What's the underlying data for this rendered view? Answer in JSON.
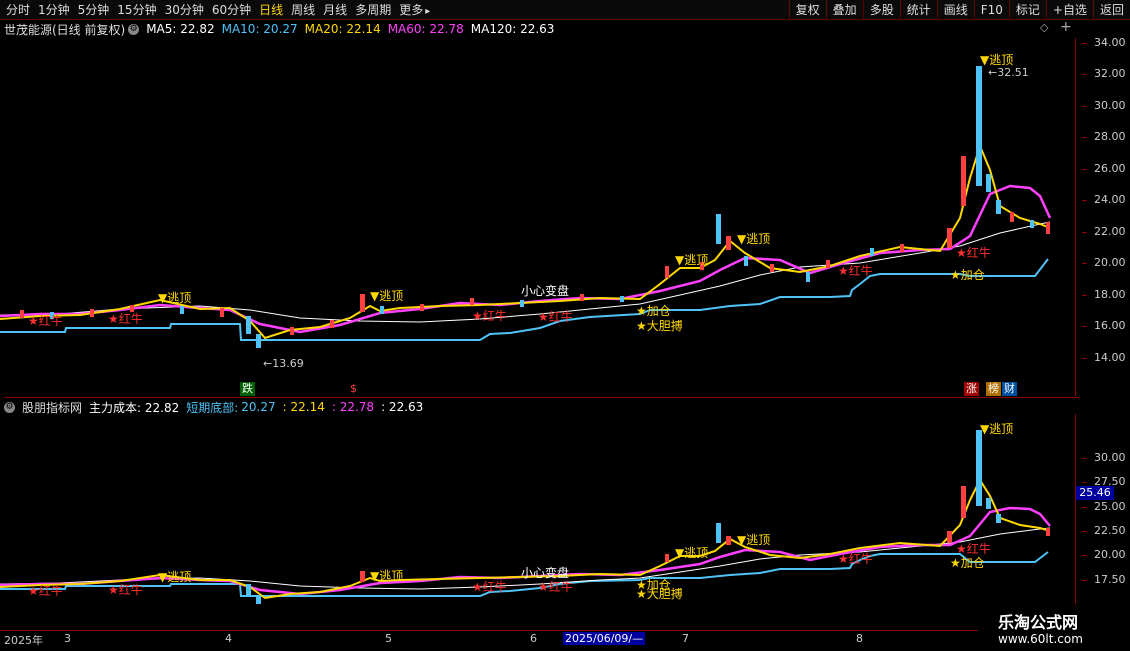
{
  "toolbar": {
    "periods": [
      "分时",
      "1分钟",
      "5分钟",
      "15分钟",
      "30分钟",
      "60分钟",
      "日线",
      "周线",
      "月线",
      "多周期",
      "更多"
    ],
    "active_index": 6,
    "more_arrow": "▸",
    "right_buttons": [
      "复权",
      "叠加",
      "多股",
      "统计",
      "画线",
      "F10",
      "标记",
      "+自选",
      "返回"
    ]
  },
  "top_info": {
    "title": "世茂能源(日线 前复权)",
    "ma5": "MA5: 22.82",
    "ma10": "MA10: 20.27",
    "ma20": "MA20: 22.14",
    "ma60": "MA60: 22.78",
    "ma120": "MA120: 22.63",
    "diamond": "◇",
    "plus": "+",
    "colors": {
      "ma5": "#ffffff",
      "ma10": "#4fc3f7",
      "ma20": "#ffd800",
      "ma60": "#ff40ff",
      "ma120": "#ffffff"
    }
  },
  "bottom_info": {
    "title": "股朋指标网",
    "main_cost": "主力成本: 22.82",
    "short_bottom_label": "短期底部:",
    "v1": "20.27",
    "v2": ": 22.14",
    "v3": ": 22.78",
    "v4": ": 22.63"
  },
  "top_axis": [
    "34.00",
    "32.00",
    "30.00",
    "28.00",
    "26.00",
    "24.00",
    "22.00",
    "20.00",
    "18.00",
    "16.00",
    "14.00"
  ],
  "bottom_axis": [
    "30.00",
    "27.50",
    "25.00",
    "22.50",
    "20.00",
    "17.50"
  ],
  "bottom_price_tag": "25.46",
  "annotations": {
    "escape_top": "▼逃顶",
    "red_bull": "★红牛",
    "add_position": "★加仓",
    "bold_fight": "★大胆搏",
    "caution": "小心变盘",
    "high_value": "32.51",
    "low_value": "13.69"
  },
  "top_badges": {
    "drop": "跌",
    "sell": "$",
    "rise": "涨",
    "rank": "榜",
    "fin": "财"
  },
  "date_bar": {
    "labels": [
      "2025年",
      "3",
      "4",
      "5",
      "6",
      "2025/06/09/—",
      "7",
      "8"
    ]
  },
  "watermark": {
    "name": "乐淘公式网",
    "url": "www.60lt.com"
  },
  "chart_data": {
    "type": "line",
    "title": "世茂能源(日线 前复权)",
    "price_points": [
      16.4,
      16.6,
      16.8,
      16.9,
      16.7,
      16.8,
      17.1,
      17.4,
      17.6,
      17.2,
      16.9,
      17.0,
      16.8,
      15.2,
      15.4,
      15.8,
      16.1,
      16.4,
      16.6,
      17.3,
      17.1,
      17.0,
      16.9,
      17.2,
      17.4,
      17.6,
      17.7,
      17.8,
      18.1,
      19.4,
      19.8,
      20.6,
      21.3,
      20.4,
      19.8,
      19.5,
      19.2,
      19.6,
      20.0,
      20.3,
      20.6,
      20.9,
      20.6,
      20.2,
      26.8,
      32.51,
      24.0,
      22.9,
      22.6,
      22.3
    ],
    "high": 32.51,
    "low": 13.69,
    "ylim": [
      13.0,
      34.5
    ]
  }
}
